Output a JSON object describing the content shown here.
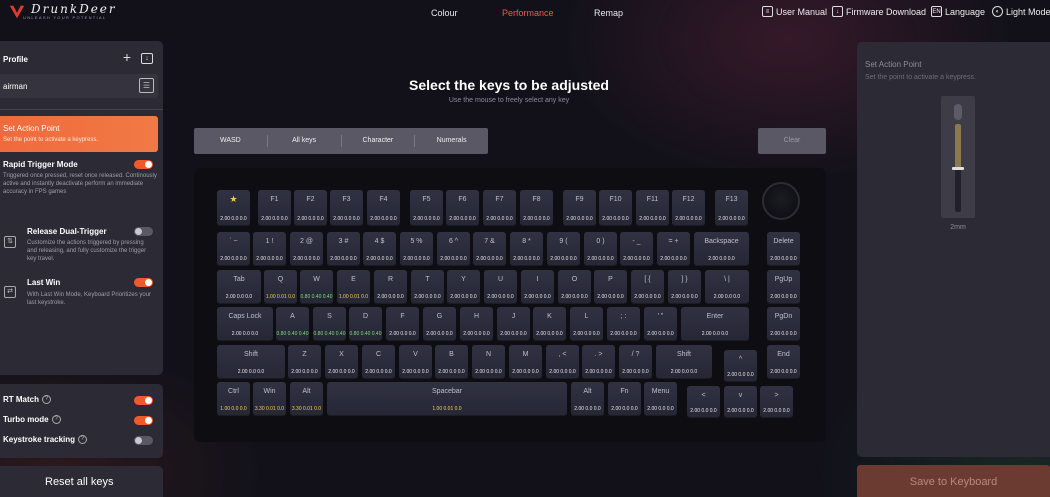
{
  "header": {
    "logo_text": "DrunkDeer",
    "logo_tagline": "UNLEASH YOUR POTENTIAL",
    "nav": [
      "Colour",
      "Performance",
      "Remap"
    ],
    "active_nav": "Performance",
    "tools": {
      "user_manual": "User Manual",
      "firmware": "Firmware Download",
      "language_icon": "EN",
      "language": "Language",
      "light_mode": "Light Mode"
    }
  },
  "sidebar": {
    "profile_title": "Profile",
    "profile_name": "airman",
    "action_point": {
      "title": "Set Action Point",
      "desc": "Set the point to activate a keypress."
    },
    "modes": [
      {
        "title": "Rapid Trigger Mode",
        "desc": "Triggered once pressed, reset once released. Continously active and instantly deactivate perform an immediate accuracy in FPS games",
        "enabled": true
      },
      {
        "title": "Release Dual-Trigger",
        "desc": "Customize the actions triggered by pressing and releasing, and fully customize the trigger key travel.",
        "enabled": false
      },
      {
        "title": "Last Win",
        "desc": "With Last Win Mode, Keyboard Prioritizes your last keystroke.",
        "enabled": true
      }
    ],
    "settings": [
      {
        "label": "RT Match",
        "enabled": true
      },
      {
        "label": "Turbo mode",
        "enabled": true
      },
      {
        "label": "Keystroke tracking",
        "enabled": false
      }
    ],
    "reset_label": "Reset all keys"
  },
  "main": {
    "title": "Select the keys to be adjusted",
    "subtitle": "Use the mouse to freely select any key",
    "filters": [
      "WASD",
      "All keys",
      "Character",
      "Numerals"
    ],
    "clear_label": "Clear"
  },
  "colors": {
    "accent": "#f06a3c",
    "value_white": "#e8e8ee",
    "value_yellow": "#f2d24b",
    "value_green": "#7fdc7a",
    "value_blue": "#6fb8f0",
    "value_cyan": "#7fe0d4"
  },
  "keyboard_rows": [
    [
      {
        "label": "★",
        "value": "2.00 0.0 0.0"
      },
      {
        "label": "F1",
        "value": "2.00 0.0 0.0"
      },
      {
        "label": "F2",
        "value": "2.00 0.0 0.0"
      },
      {
        "label": "F3",
        "value": "2.00 0.0 0.0"
      },
      {
        "label": "F4",
        "value": "2.00 0.0 0.0"
      },
      {
        "label": "F5",
        "value": "2.00 0.0 0.0"
      },
      {
        "label": "F6",
        "value": "2.00 0.0 0.0"
      },
      {
        "label": "F7",
        "value": "2.00 0.0 0.0"
      },
      {
        "label": "F8",
        "value": "2.00 0.0 0.0"
      },
      {
        "label": "F9",
        "value": "2.00 0.0 0.0"
      },
      {
        "label": "F10",
        "value": "2.00 0.0 0.0"
      },
      {
        "label": "F11",
        "value": "2.00 0.0 0.0"
      },
      {
        "label": "F12",
        "value": "2.00 0.0 0.0"
      },
      {
        "label": "F13",
        "value": "2.00 0.0 0.0"
      }
    ],
    [
      {
        "label": "` ~",
        "value": "2.00 0.0 0.0"
      },
      {
        "label": "1 !",
        "value": "2.00 0.0 0.0"
      },
      {
        "label": "2 @",
        "value": "2.00 0.0 0.0"
      },
      {
        "label": "3 #",
        "value": "2.00 0.0 0.0"
      },
      {
        "label": "4 $",
        "value": "2.00 0.0 0.0"
      },
      {
        "label": "5 %",
        "value": "2.00 0.0 0.0"
      },
      {
        "label": "6 ^",
        "value": "2.00 0.0 0.0"
      },
      {
        "label": "7 &",
        "value": "2.00 0.0 0.0"
      },
      {
        "label": "8 *",
        "value": "2.00 0.0 0.0"
      },
      {
        "label": "9 (",
        "value": "2.00 0.0 0.0"
      },
      {
        "label": "0 )",
        "value": "2.00 0.0 0.0"
      },
      {
        "label": "- _",
        "value": "2.00 0.0 0.0"
      },
      {
        "label": "= +",
        "value": "2.00 0.0 0.0"
      },
      {
        "label": "Backspace",
        "value": "2.00 0.0 0.0"
      },
      {
        "label": "Delete",
        "value": "2.00 0.0 0.0"
      }
    ],
    [
      {
        "label": "Tab",
        "value": "2.00 0.0 0.0"
      },
      {
        "label": "Q",
        "value": "1.00 0.01 0.0",
        "color": "yellow"
      },
      {
        "label": "W",
        "value": "0.80 0.40 0.40",
        "color": "green"
      },
      {
        "label": "E",
        "value": "1.00 0.01 0.0",
        "color": "yellow"
      },
      {
        "label": "R",
        "value": "2.00 0.0 0.0"
      },
      {
        "label": "T",
        "value": "2.00 0.0 0.0"
      },
      {
        "label": "Y",
        "value": "2.00 0.0 0.0"
      },
      {
        "label": "U",
        "value": "2.00 0.0 0.0"
      },
      {
        "label": "I",
        "value": "2.00 0.0 0.0"
      },
      {
        "label": "O",
        "value": "2.00 0.0 0.0"
      },
      {
        "label": "P",
        "value": "2.00 0.0 0.0"
      },
      {
        "label": "[ {",
        "value": "2.00 0.0 0.0"
      },
      {
        "label": "] }",
        "value": "2.00 0.0 0.0"
      },
      {
        "label": "\\ |",
        "value": "2.00 0.0 0.0"
      },
      {
        "label": "PgUp",
        "value": "2.00 0.0 0.0"
      }
    ],
    [
      {
        "label": "Caps Lock",
        "value": "2.00 0.0 0.0"
      },
      {
        "label": "A",
        "value": "0.80 0.40 0.40",
        "color": "green"
      },
      {
        "label": "S",
        "value": "0.80 0.40 0.40",
        "color": "green"
      },
      {
        "label": "D",
        "value": "0.80 0.40 0.40",
        "color": "green"
      },
      {
        "label": "F",
        "value": "2.00 0.0 0.0"
      },
      {
        "label": "G",
        "value": "2.00 0.0 0.0"
      },
      {
        "label": "H",
        "value": "2.00 0.0 0.0"
      },
      {
        "label": "J",
        "value": "2.00 0.0 0.0"
      },
      {
        "label": "K",
        "value": "2.00 0.0 0.0"
      },
      {
        "label": "L",
        "value": "2.00 0.0 0.0"
      },
      {
        "label": "; :",
        "value": "2.00 0.0 0.0"
      },
      {
        "label": "' \"",
        "value": "2.00 0.0 0.0"
      },
      {
        "label": "Enter",
        "value": "2.00 0.0 0.0"
      },
      {
        "label": "PgDn",
        "value": "2.00 0.0 0.0"
      }
    ],
    [
      {
        "label": "Shift",
        "value": "2.00 0.0 0.0"
      },
      {
        "label": "Z",
        "value": "2.00 0.0 0.0"
      },
      {
        "label": "X",
        "value": "2.00 0.0 0.0"
      },
      {
        "label": "C",
        "value": "2.00 0.0 0.0"
      },
      {
        "label": "V",
        "value": "2.00 0.0 0.0"
      },
      {
        "label": "B",
        "value": "2.00 0.0 0.0"
      },
      {
        "label": "N",
        "value": "2.00 0.0 0.0"
      },
      {
        "label": "M",
        "value": "2.00 0.0 0.0"
      },
      {
        "label": ", <",
        "value": "2.00 0.0 0.0"
      },
      {
        "label": ". >",
        "value": "2.00 0.0 0.0"
      },
      {
        "label": "/ ?",
        "value": "2.00 0.0 0.0"
      },
      {
        "label": "Shift",
        "value": "2.00 0.0 0.0"
      },
      {
        "label": "^",
        "value": "2.00 0.0 0.0"
      },
      {
        "label": "End",
        "value": "2.00 0.0 0.0"
      }
    ],
    [
      {
        "label": "Ctrl",
        "value": "1.00 0.0 0.0",
        "color": "yellow"
      },
      {
        "label": "Win",
        "value": "3.30 0.01 0.0",
        "color": "yellow"
      },
      {
        "label": "Alt",
        "value": "3.30 0.01 0.0",
        "color": "yellow"
      },
      {
        "label": "Spacebar",
        "value": "1.00 0.01 0.0",
        "color": "yellow"
      },
      {
        "label": "Alt",
        "value": "2.00 0.0 0.0"
      },
      {
        "label": "Fn",
        "value": "2.00 0.0 0.0"
      },
      {
        "label": "Menu",
        "value": "2.00 0.0 0.0"
      },
      {
        "label": "<",
        "value": "2.00 0.0 0.0"
      },
      {
        "label": "v",
        "value": "2.00 0.0 0.0"
      },
      {
        "label": ">",
        "value": "2.00 0.0 0.0"
      }
    ]
  ],
  "right_panel": {
    "title": "Set Action Point",
    "desc": "Set the point to activate a keypress.",
    "travel_fraction": 0.5,
    "value_text": "2mm",
    "save_label": "Save to Keyboard"
  }
}
